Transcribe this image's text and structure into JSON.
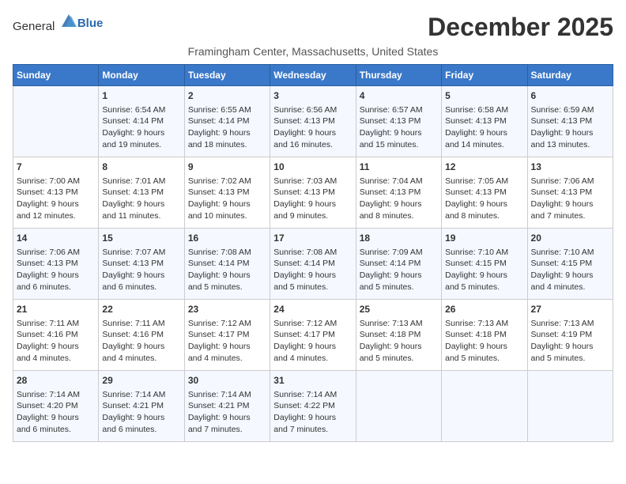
{
  "header": {
    "logo_general": "General",
    "logo_blue": "Blue",
    "month_year": "December 2025",
    "location": "Framingham Center, Massachusetts, United States"
  },
  "days_of_week": [
    "Sunday",
    "Monday",
    "Tuesday",
    "Wednesday",
    "Thursday",
    "Friday",
    "Saturday"
  ],
  "weeks": [
    [
      {
        "day": "",
        "info": ""
      },
      {
        "day": "1",
        "info": "Sunrise: 6:54 AM\nSunset: 4:14 PM\nDaylight: 9 hours\nand 19 minutes."
      },
      {
        "day": "2",
        "info": "Sunrise: 6:55 AM\nSunset: 4:14 PM\nDaylight: 9 hours\nand 18 minutes."
      },
      {
        "day": "3",
        "info": "Sunrise: 6:56 AM\nSunset: 4:13 PM\nDaylight: 9 hours\nand 16 minutes."
      },
      {
        "day": "4",
        "info": "Sunrise: 6:57 AM\nSunset: 4:13 PM\nDaylight: 9 hours\nand 15 minutes."
      },
      {
        "day": "5",
        "info": "Sunrise: 6:58 AM\nSunset: 4:13 PM\nDaylight: 9 hours\nand 14 minutes."
      },
      {
        "day": "6",
        "info": "Sunrise: 6:59 AM\nSunset: 4:13 PM\nDaylight: 9 hours\nand 13 minutes."
      }
    ],
    [
      {
        "day": "7",
        "info": "Sunrise: 7:00 AM\nSunset: 4:13 PM\nDaylight: 9 hours\nand 12 minutes."
      },
      {
        "day": "8",
        "info": "Sunrise: 7:01 AM\nSunset: 4:13 PM\nDaylight: 9 hours\nand 11 minutes."
      },
      {
        "day": "9",
        "info": "Sunrise: 7:02 AM\nSunset: 4:13 PM\nDaylight: 9 hours\nand 10 minutes."
      },
      {
        "day": "10",
        "info": "Sunrise: 7:03 AM\nSunset: 4:13 PM\nDaylight: 9 hours\nand 9 minutes."
      },
      {
        "day": "11",
        "info": "Sunrise: 7:04 AM\nSunset: 4:13 PM\nDaylight: 9 hours\nand 8 minutes."
      },
      {
        "day": "12",
        "info": "Sunrise: 7:05 AM\nSunset: 4:13 PM\nDaylight: 9 hours\nand 8 minutes."
      },
      {
        "day": "13",
        "info": "Sunrise: 7:06 AM\nSunset: 4:13 PM\nDaylight: 9 hours\nand 7 minutes."
      }
    ],
    [
      {
        "day": "14",
        "info": "Sunrise: 7:06 AM\nSunset: 4:13 PM\nDaylight: 9 hours\nand 6 minutes."
      },
      {
        "day": "15",
        "info": "Sunrise: 7:07 AM\nSunset: 4:13 PM\nDaylight: 9 hours\nand 6 minutes."
      },
      {
        "day": "16",
        "info": "Sunrise: 7:08 AM\nSunset: 4:14 PM\nDaylight: 9 hours\nand 5 minutes."
      },
      {
        "day": "17",
        "info": "Sunrise: 7:08 AM\nSunset: 4:14 PM\nDaylight: 9 hours\nand 5 minutes."
      },
      {
        "day": "18",
        "info": "Sunrise: 7:09 AM\nSunset: 4:14 PM\nDaylight: 9 hours\nand 5 minutes."
      },
      {
        "day": "19",
        "info": "Sunrise: 7:10 AM\nSunset: 4:15 PM\nDaylight: 9 hours\nand 5 minutes."
      },
      {
        "day": "20",
        "info": "Sunrise: 7:10 AM\nSunset: 4:15 PM\nDaylight: 9 hours\nand 4 minutes."
      }
    ],
    [
      {
        "day": "21",
        "info": "Sunrise: 7:11 AM\nSunset: 4:16 PM\nDaylight: 9 hours\nand 4 minutes."
      },
      {
        "day": "22",
        "info": "Sunrise: 7:11 AM\nSunset: 4:16 PM\nDaylight: 9 hours\nand 4 minutes."
      },
      {
        "day": "23",
        "info": "Sunrise: 7:12 AM\nSunset: 4:17 PM\nDaylight: 9 hours\nand 4 minutes."
      },
      {
        "day": "24",
        "info": "Sunrise: 7:12 AM\nSunset: 4:17 PM\nDaylight: 9 hours\nand 4 minutes."
      },
      {
        "day": "25",
        "info": "Sunrise: 7:13 AM\nSunset: 4:18 PM\nDaylight: 9 hours\nand 5 minutes."
      },
      {
        "day": "26",
        "info": "Sunrise: 7:13 AM\nSunset: 4:18 PM\nDaylight: 9 hours\nand 5 minutes."
      },
      {
        "day": "27",
        "info": "Sunrise: 7:13 AM\nSunset: 4:19 PM\nDaylight: 9 hours\nand 5 minutes."
      }
    ],
    [
      {
        "day": "28",
        "info": "Sunrise: 7:14 AM\nSunset: 4:20 PM\nDaylight: 9 hours\nand 6 minutes."
      },
      {
        "day": "29",
        "info": "Sunrise: 7:14 AM\nSunset: 4:21 PM\nDaylight: 9 hours\nand 6 minutes."
      },
      {
        "day": "30",
        "info": "Sunrise: 7:14 AM\nSunset: 4:21 PM\nDaylight: 9 hours\nand 7 minutes."
      },
      {
        "day": "31",
        "info": "Sunrise: 7:14 AM\nSunset: 4:22 PM\nDaylight: 9 hours\nand 7 minutes."
      },
      {
        "day": "",
        "info": ""
      },
      {
        "day": "",
        "info": ""
      },
      {
        "day": "",
        "info": ""
      }
    ]
  ]
}
